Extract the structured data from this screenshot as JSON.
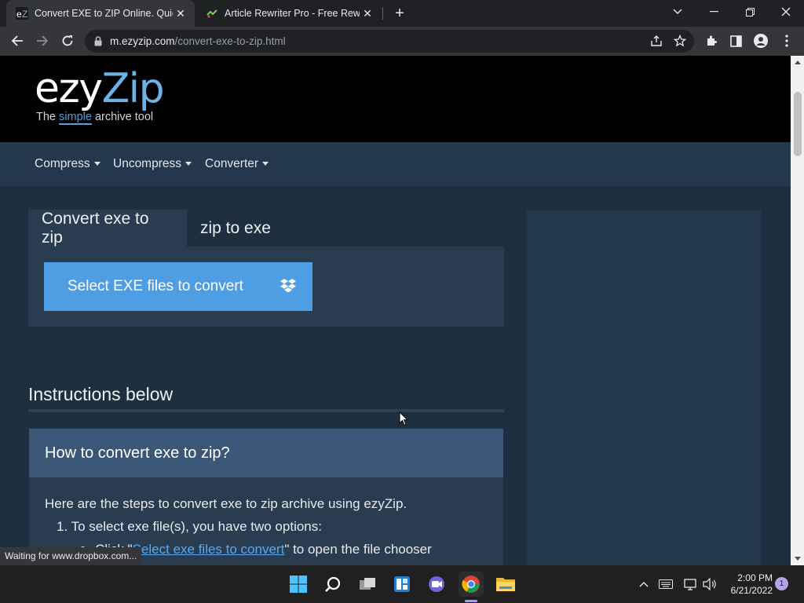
{
  "browser": {
    "tabs": [
      {
        "title": "Convert EXE to ZIP Online. Quick",
        "favicon": "ezyzip-favicon",
        "active": true
      },
      {
        "title": "Article Rewriter Pro - Free Rewrite",
        "favicon": "article-rewriter-favicon",
        "active": false
      }
    ],
    "url_host": "m.ezyzip.com",
    "url_path": "/convert-exe-to-zip.html",
    "status_text": "Waiting for www.dropbox.com..."
  },
  "site": {
    "logo_main_a": "ezy",
    "logo_main_b": "Zip",
    "logo_tag_a": "The ",
    "logo_tag_simple": "simple",
    "logo_tag_b": " archive tool",
    "nav": [
      "Compress",
      "Uncompress",
      "Converter"
    ]
  },
  "converter": {
    "tab_active": "Convert exe to zip",
    "tab_other": "zip to exe",
    "select_button": "Select EXE files to convert"
  },
  "instructions": {
    "heading": "Instructions below",
    "card_title": "How to convert exe to zip?",
    "intro": "Here are the steps to convert exe to zip archive using ezyZip.",
    "step1": "1. To select exe file(s), you have two options:",
    "sub1_pre": "Click \"",
    "sub1_link": "Select exe files to convert",
    "sub1_post": "\" to open the file chooser"
  },
  "taskbar": {
    "time": "2:00 PM",
    "date": "6/21/2022",
    "notification_count": "1"
  },
  "colors": {
    "accent_button": "#4f9de3",
    "page_bg": "#1e2f40",
    "card_header": "#3b5778"
  }
}
